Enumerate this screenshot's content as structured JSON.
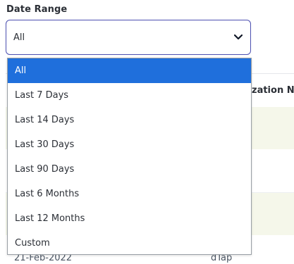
{
  "date_range": {
    "label": "Date Range",
    "selected_value": "All",
    "options": [
      {
        "label": "All",
        "selected": true
      },
      {
        "label": "Last 7 Days",
        "selected": false
      },
      {
        "label": "Last 14 Days",
        "selected": false
      },
      {
        "label": "Last 30 Days",
        "selected": false
      },
      {
        "label": "Last 90 Days",
        "selected": false
      },
      {
        "label": "Last 6 Months",
        "selected": false
      },
      {
        "label": "Last 12 Months",
        "selected": false
      },
      {
        "label": "Custom",
        "selected": false
      }
    ],
    "chevron_icon": "chevron-down-icon",
    "accent_color": "#4b4fb0",
    "highlight_color": "#1f6fdc"
  },
  "background_table": {
    "partial_header": "zation N",
    "visible_row": {
      "date": "21-Feb-2022",
      "vaccine": "dTap"
    },
    "row_tint_color": "#f5f7ea"
  }
}
